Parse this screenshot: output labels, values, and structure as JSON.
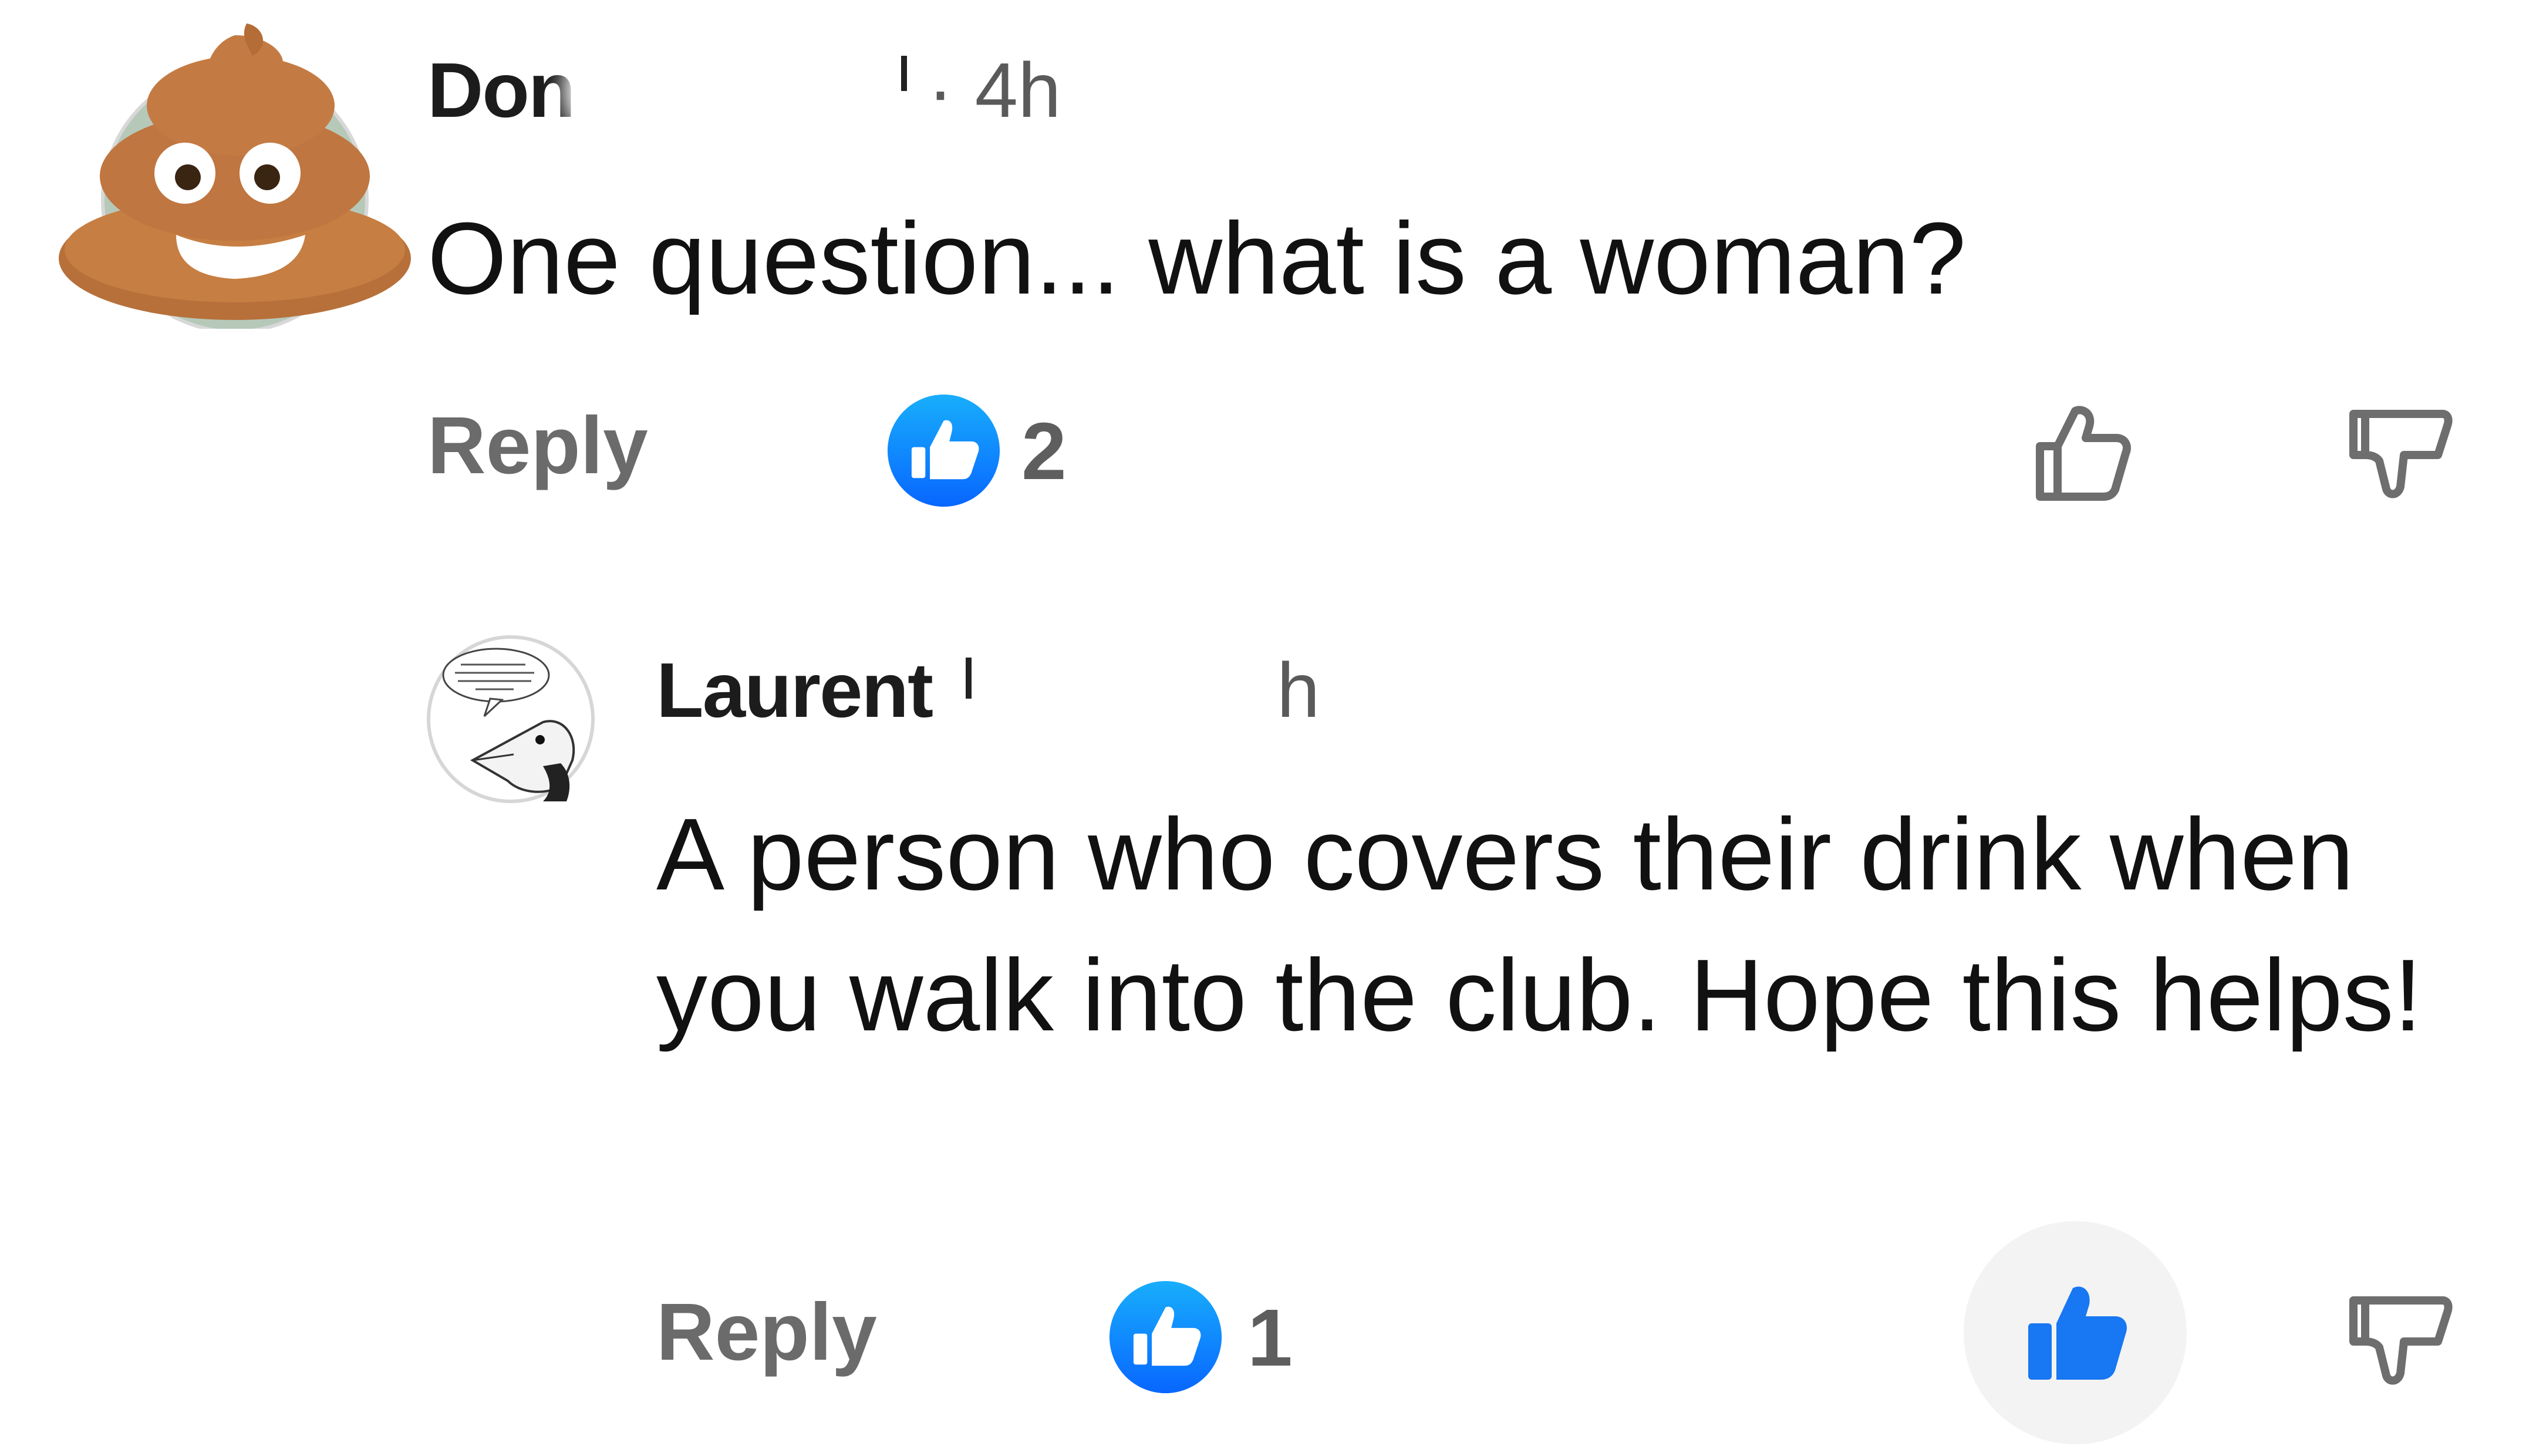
{
  "comments": [
    {
      "author": "Don",
      "time": "· 4h",
      "text": "One question... what is a woman?",
      "reply_label": "Reply",
      "like_count": "2",
      "avatar_icon": "poop-emoji-icon"
    },
    {
      "author": "Laurent",
      "time": "h",
      "text": "A person who covers their drink when you walk into the club. Hope this helps!",
      "reply_label": "Reply",
      "like_count": "1",
      "avatar_icon": "opossum-avatar-icon",
      "liked": true
    }
  ],
  "colors": {
    "accent_blue": "#1877f2",
    "reply_gray": "#6b6b6b",
    "icon_gray": "#6e6e6e"
  }
}
